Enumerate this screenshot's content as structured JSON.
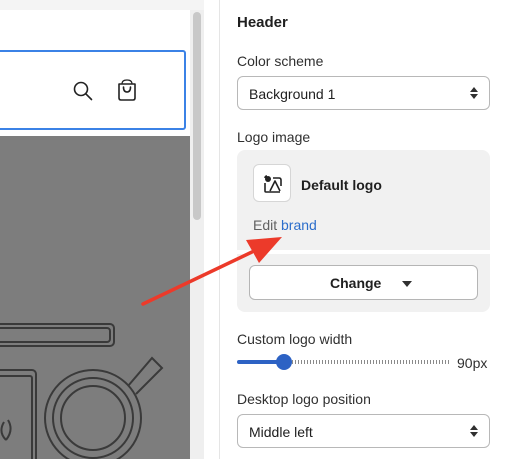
{
  "panel": {
    "title": "Header",
    "color_scheme": {
      "label": "Color scheme",
      "value": "Background 1"
    },
    "logo_image": {
      "label": "Logo image",
      "name": "Default logo",
      "edit_prefix": "Edit",
      "edit_link": "brand",
      "change_button": "Change"
    },
    "logo_width": {
      "label": "Custom logo width",
      "value_text": "90px",
      "fraction": 0.22
    },
    "desktop_logo_position": {
      "label": "Desktop logo position",
      "value": "Middle left"
    }
  },
  "colors": {
    "accent": "#2d62c4",
    "link": "#2c6ecb",
    "annotation_arrow": "#ec3a2a",
    "focus_outline": "#3b82e6"
  },
  "icons": {
    "preview": [
      "search-icon",
      "cart-bag-icon"
    ],
    "panel": [
      "image-icon",
      "caret-updown-icon",
      "caret-down-icon"
    ]
  }
}
